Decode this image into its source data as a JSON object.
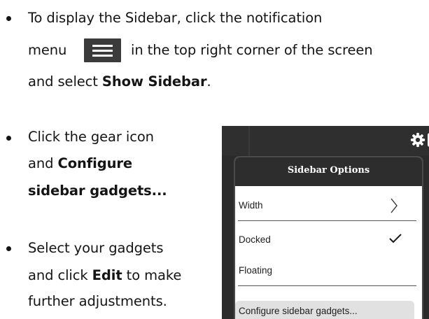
{
  "instructions": {
    "step1": {
      "line1": "To display the Sidebar, click the notification",
      "line2_before": "menu",
      "line2_after": "in the top right corner of the screen",
      "line3_before": "and select ",
      "line3_bold": "Show Sidebar",
      "line3_after": "."
    },
    "step2": {
      "line1": "Click the gear icon",
      "line2_before": "and ",
      "line2_bold": "Configure",
      "line3_bold": "sidebar gadgets..."
    },
    "step3": {
      "line1": "Select your gadgets",
      "line2_before": "and click ",
      "line2_bold": "Edit",
      "line2_after": " to make",
      "line3": "further adjustments."
    }
  },
  "menu_icon": "hamburger-menu-icon",
  "sidebar_options": {
    "title": "Sidebar Options",
    "width_label": "Width",
    "docked_label": "Docked",
    "floating_label": "Floating",
    "configure_label": "Configure sidebar gadgets...",
    "docked_selected": true
  },
  "topbar_icons": [
    "gear-icon",
    "play-icon"
  ],
  "colors": {
    "text": "#141414",
    "menu_icon_bg": "#3b3b3b",
    "popup_header": "#2d2d2d",
    "highlight": "#e1e1e1"
  }
}
